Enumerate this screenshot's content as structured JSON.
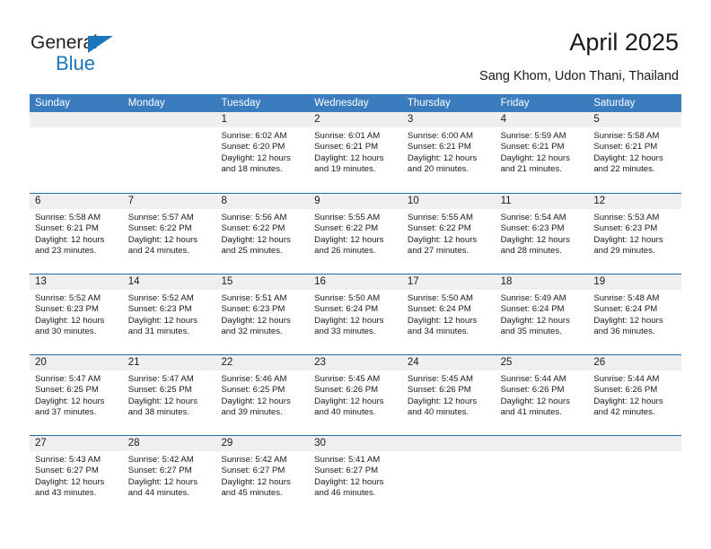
{
  "brand": {
    "name_part1": "General",
    "name_part2": "Blue",
    "accent_color": "#1c76bc",
    "triangle_icon": "triangle-icon"
  },
  "header": {
    "title": "April 2025",
    "subtitle": "Sang Khom, Udon Thani, Thailand"
  },
  "calendar": {
    "header_bg_color": "#3a7cbe",
    "row_divider_color": "#1f6cb0",
    "daynum_band_color": "#efefef",
    "weekdays": [
      "Sunday",
      "Monday",
      "Tuesday",
      "Wednesday",
      "Thursday",
      "Friday",
      "Saturday"
    ],
    "weeks": [
      [
        {
          "day": "",
          "sunrise": "",
          "sunset": "",
          "daylight1": "",
          "daylight2": ""
        },
        {
          "day": "",
          "sunrise": "",
          "sunset": "",
          "daylight1": "",
          "daylight2": ""
        },
        {
          "day": "1",
          "sunrise": "Sunrise: 6:02 AM",
          "sunset": "Sunset: 6:20 PM",
          "daylight1": "Daylight: 12 hours",
          "daylight2": "and 18 minutes."
        },
        {
          "day": "2",
          "sunrise": "Sunrise: 6:01 AM",
          "sunset": "Sunset: 6:21 PM",
          "daylight1": "Daylight: 12 hours",
          "daylight2": "and 19 minutes."
        },
        {
          "day": "3",
          "sunrise": "Sunrise: 6:00 AM",
          "sunset": "Sunset: 6:21 PM",
          "daylight1": "Daylight: 12 hours",
          "daylight2": "and 20 minutes."
        },
        {
          "day": "4",
          "sunrise": "Sunrise: 5:59 AM",
          "sunset": "Sunset: 6:21 PM",
          "daylight1": "Daylight: 12 hours",
          "daylight2": "and 21 minutes."
        },
        {
          "day": "5",
          "sunrise": "Sunrise: 5:58 AM",
          "sunset": "Sunset: 6:21 PM",
          "daylight1": "Daylight: 12 hours",
          "daylight2": "and 22 minutes."
        }
      ],
      [
        {
          "day": "6",
          "sunrise": "Sunrise: 5:58 AM",
          "sunset": "Sunset: 6:21 PM",
          "daylight1": "Daylight: 12 hours",
          "daylight2": "and 23 minutes."
        },
        {
          "day": "7",
          "sunrise": "Sunrise: 5:57 AM",
          "sunset": "Sunset: 6:22 PM",
          "daylight1": "Daylight: 12 hours",
          "daylight2": "and 24 minutes."
        },
        {
          "day": "8",
          "sunrise": "Sunrise: 5:56 AM",
          "sunset": "Sunset: 6:22 PM",
          "daylight1": "Daylight: 12 hours",
          "daylight2": "and 25 minutes."
        },
        {
          "day": "9",
          "sunrise": "Sunrise: 5:55 AM",
          "sunset": "Sunset: 6:22 PM",
          "daylight1": "Daylight: 12 hours",
          "daylight2": "and 26 minutes."
        },
        {
          "day": "10",
          "sunrise": "Sunrise: 5:55 AM",
          "sunset": "Sunset: 6:22 PM",
          "daylight1": "Daylight: 12 hours",
          "daylight2": "and 27 minutes."
        },
        {
          "day": "11",
          "sunrise": "Sunrise: 5:54 AM",
          "sunset": "Sunset: 6:23 PM",
          "daylight1": "Daylight: 12 hours",
          "daylight2": "and 28 minutes."
        },
        {
          "day": "12",
          "sunrise": "Sunrise: 5:53 AM",
          "sunset": "Sunset: 6:23 PM",
          "daylight1": "Daylight: 12 hours",
          "daylight2": "and 29 minutes."
        }
      ],
      [
        {
          "day": "13",
          "sunrise": "Sunrise: 5:52 AM",
          "sunset": "Sunset: 6:23 PM",
          "daylight1": "Daylight: 12 hours",
          "daylight2": "and 30 minutes."
        },
        {
          "day": "14",
          "sunrise": "Sunrise: 5:52 AM",
          "sunset": "Sunset: 6:23 PM",
          "daylight1": "Daylight: 12 hours",
          "daylight2": "and 31 minutes."
        },
        {
          "day": "15",
          "sunrise": "Sunrise: 5:51 AM",
          "sunset": "Sunset: 6:23 PM",
          "daylight1": "Daylight: 12 hours",
          "daylight2": "and 32 minutes."
        },
        {
          "day": "16",
          "sunrise": "Sunrise: 5:50 AM",
          "sunset": "Sunset: 6:24 PM",
          "daylight1": "Daylight: 12 hours",
          "daylight2": "and 33 minutes."
        },
        {
          "day": "17",
          "sunrise": "Sunrise: 5:50 AM",
          "sunset": "Sunset: 6:24 PM",
          "daylight1": "Daylight: 12 hours",
          "daylight2": "and 34 minutes."
        },
        {
          "day": "18",
          "sunrise": "Sunrise: 5:49 AM",
          "sunset": "Sunset: 6:24 PM",
          "daylight1": "Daylight: 12 hours",
          "daylight2": "and 35 minutes."
        },
        {
          "day": "19",
          "sunrise": "Sunrise: 5:48 AM",
          "sunset": "Sunset: 6:24 PM",
          "daylight1": "Daylight: 12 hours",
          "daylight2": "and 36 minutes."
        }
      ],
      [
        {
          "day": "20",
          "sunrise": "Sunrise: 5:47 AM",
          "sunset": "Sunset: 6:25 PM",
          "daylight1": "Daylight: 12 hours",
          "daylight2": "and 37 minutes."
        },
        {
          "day": "21",
          "sunrise": "Sunrise: 5:47 AM",
          "sunset": "Sunset: 6:25 PM",
          "daylight1": "Daylight: 12 hours",
          "daylight2": "and 38 minutes."
        },
        {
          "day": "22",
          "sunrise": "Sunrise: 5:46 AM",
          "sunset": "Sunset: 6:25 PM",
          "daylight1": "Daylight: 12 hours",
          "daylight2": "and 39 minutes."
        },
        {
          "day": "23",
          "sunrise": "Sunrise: 5:45 AM",
          "sunset": "Sunset: 6:26 PM",
          "daylight1": "Daylight: 12 hours",
          "daylight2": "and 40 minutes."
        },
        {
          "day": "24",
          "sunrise": "Sunrise: 5:45 AM",
          "sunset": "Sunset: 6:26 PM",
          "daylight1": "Daylight: 12 hours",
          "daylight2": "and 40 minutes."
        },
        {
          "day": "25",
          "sunrise": "Sunrise: 5:44 AM",
          "sunset": "Sunset: 6:26 PM",
          "daylight1": "Daylight: 12 hours",
          "daylight2": "and 41 minutes."
        },
        {
          "day": "26",
          "sunrise": "Sunrise: 5:44 AM",
          "sunset": "Sunset: 6:26 PM",
          "daylight1": "Daylight: 12 hours",
          "daylight2": "and 42 minutes."
        }
      ],
      [
        {
          "day": "27",
          "sunrise": "Sunrise: 5:43 AM",
          "sunset": "Sunset: 6:27 PM",
          "daylight1": "Daylight: 12 hours",
          "daylight2": "and 43 minutes."
        },
        {
          "day": "28",
          "sunrise": "Sunrise: 5:42 AM",
          "sunset": "Sunset: 6:27 PM",
          "daylight1": "Daylight: 12 hours",
          "daylight2": "and 44 minutes."
        },
        {
          "day": "29",
          "sunrise": "Sunrise: 5:42 AM",
          "sunset": "Sunset: 6:27 PM",
          "daylight1": "Daylight: 12 hours",
          "daylight2": "and 45 minutes."
        },
        {
          "day": "30",
          "sunrise": "Sunrise: 5:41 AM",
          "sunset": "Sunset: 6:27 PM",
          "daylight1": "Daylight: 12 hours",
          "daylight2": "and 46 minutes."
        },
        {
          "day": "",
          "sunrise": "",
          "sunset": "",
          "daylight1": "",
          "daylight2": ""
        },
        {
          "day": "",
          "sunrise": "",
          "sunset": "",
          "daylight1": "",
          "daylight2": ""
        },
        {
          "day": "",
          "sunrise": "",
          "sunset": "",
          "daylight1": "",
          "daylight2": ""
        }
      ]
    ]
  }
}
